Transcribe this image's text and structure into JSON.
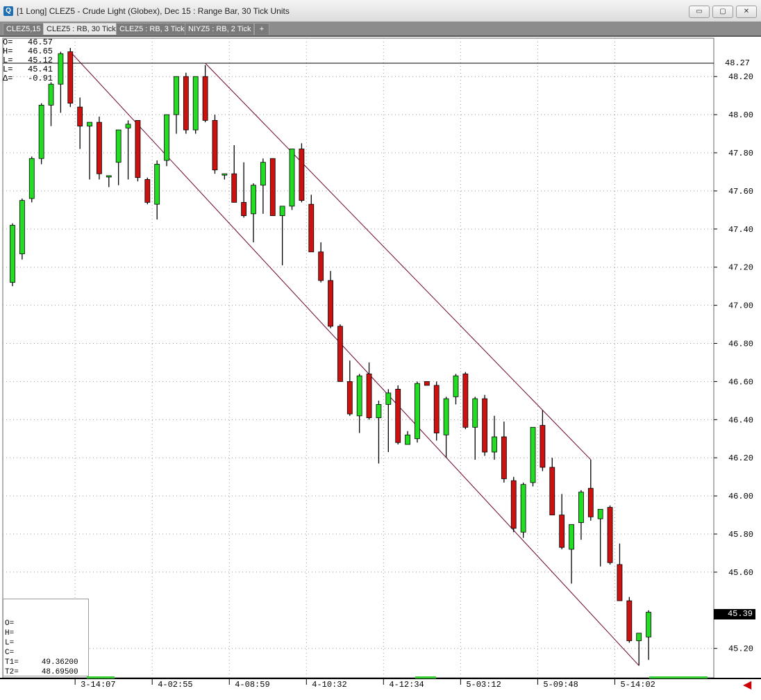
{
  "window": {
    "title": "[1 Long]  CLEZ5 - Crude Light (Globex), Dec 15 : Range Bar, 30 Tick Units",
    "app_icon_glyph": "Q",
    "buttons": {
      "minimize": "▭",
      "restore": "▢",
      "close": "✕"
    }
  },
  "tabs": [
    {
      "label": "CLEZ5,15",
      "active": false
    },
    {
      "label": "CLEZ5 : RB, 30 Tick",
      "active": true
    },
    {
      "label": "CLEZ5 : RB, 3 Tick",
      "active": false
    },
    {
      "label": "NIYZ5 : RB, 2 Tick",
      "active": false
    },
    {
      "label": "+",
      "active": false
    }
  ],
  "ohlc_panel": {
    "o": "O=   46.57",
    "h": "H=   46.65",
    "l1": "L=   45.12",
    "l2": "L=   45.41",
    "delta": "Δ=   -0.91"
  },
  "info_box": {
    "o": "O=",
    "h": "H=",
    "l": "L=",
    "c": "C=",
    "t1": "T1=     49.36200",
    "t2": "T2=     48.69500"
  },
  "price_tag": "45.39",
  "horizontal_line_tag": "48.27",
  "colors": {
    "up": "#22dd22",
    "down": "#cc1111",
    "trendline": "#6a0030",
    "grid": "#999999"
  },
  "icons": {
    "scroll_right": "arrow-left-icon"
  },
  "chart_data": {
    "type": "candlestick",
    "ylim": [
      45.08,
      48.35
    ],
    "yticks": [
      "48.20",
      "48.00",
      "47.80",
      "47.60",
      "47.40",
      "47.20",
      "47.00",
      "46.80",
      "46.60",
      "46.40",
      "46.20",
      "46.00",
      "45.80",
      "45.60",
      "45.20"
    ],
    "xticks": [
      {
        "label": "3-14:07",
        "bar": 7
      },
      {
        "label": "4-02:55",
        "bar": 15
      },
      {
        "label": "4-08:59",
        "bar": 23
      },
      {
        "label": "4-10:32",
        "bar": 31
      },
      {
        "label": "4-12:34",
        "bar": 39
      },
      {
        "label": "5-03:12",
        "bar": 47
      },
      {
        "label": "5-09:48",
        "bar": 55
      },
      {
        "label": "5-14:02",
        "bar": 63
      }
    ],
    "hline": 48.27,
    "bars": [
      {
        "o": 47.12,
        "h": 47.43,
        "l": 47.1,
        "c": 47.42
      },
      {
        "o": 47.27,
        "h": 47.56,
        "l": 47.24,
        "c": 47.55
      },
      {
        "o": 47.56,
        "h": 47.78,
        "l": 47.54,
        "c": 47.77
      },
      {
        "o": 47.77,
        "h": 48.06,
        "l": 47.74,
        "c": 48.05
      },
      {
        "o": 48.05,
        "h": 48.17,
        "l": 47.94,
        "c": 48.16
      },
      {
        "o": 48.16,
        "h": 48.33,
        "l": 48.01,
        "c": 48.32
      },
      {
        "o": 48.33,
        "h": 48.35,
        "l": 48.04,
        "c": 48.06
      },
      {
        "o": 48.04,
        "h": 48.09,
        "l": 47.82,
        "c": 47.94
      },
      {
        "o": 47.94,
        "h": 47.96,
        "l": 47.66,
        "c": 47.96
      },
      {
        "o": 47.96,
        "h": 47.99,
        "l": 47.66,
        "c": 47.69
      },
      {
        "o": 47.68,
        "h": 47.68,
        "l": 47.62,
        "c": 47.68
      },
      {
        "o": 47.75,
        "h": 47.92,
        "l": 47.63,
        "c": 47.92
      },
      {
        "o": 47.93,
        "h": 47.97,
        "l": 47.66,
        "c": 47.95
      },
      {
        "o": 47.97,
        "h": 47.97,
        "l": 47.65,
        "c": 47.67
      },
      {
        "o": 47.66,
        "h": 47.67,
        "l": 47.53,
        "c": 47.54
      },
      {
        "o": 47.53,
        "h": 47.76,
        "l": 47.45,
        "c": 47.74
      },
      {
        "o": 47.76,
        "h": 48.0,
        "l": 47.73,
        "c": 48.0
      },
      {
        "o": 48.0,
        "h": 48.2,
        "l": 47.9,
        "c": 48.2
      },
      {
        "o": 48.2,
        "h": 48.22,
        "l": 47.9,
        "c": 47.92
      },
      {
        "o": 47.92,
        "h": 48.2,
        "l": 47.9,
        "c": 48.2
      },
      {
        "o": 48.2,
        "h": 48.26,
        "l": 47.96,
        "c": 47.97
      },
      {
        "o": 47.97,
        "h": 48.0,
        "l": 47.69,
        "c": 47.71
      },
      {
        "o": 47.69,
        "h": 47.69,
        "l": 47.66,
        "c": 47.69
      },
      {
        "o": 47.69,
        "h": 47.84,
        "l": 47.54,
        "c": 47.54
      },
      {
        "o": 47.54,
        "h": 47.75,
        "l": 47.46,
        "c": 47.47
      },
      {
        "o": 47.48,
        "h": 47.64,
        "l": 47.33,
        "c": 47.63
      },
      {
        "o": 47.63,
        "h": 47.77,
        "l": 47.48,
        "c": 47.75
      },
      {
        "o": 47.77,
        "h": 47.77,
        "l": 47.47,
        "c": 47.47
      },
      {
        "o": 47.47,
        "h": 47.52,
        "l": 47.21,
        "c": 47.52
      },
      {
        "o": 47.52,
        "h": 47.82,
        "l": 47.5,
        "c": 47.82
      },
      {
        "o": 47.82,
        "h": 47.85,
        "l": 47.54,
        "c": 47.55
      },
      {
        "o": 47.53,
        "h": 47.58,
        "l": 47.28,
        "c": 47.28
      },
      {
        "o": 47.28,
        "h": 47.33,
        "l": 47.12,
        "c": 47.13
      },
      {
        "o": 47.13,
        "h": 47.18,
        "l": 46.88,
        "c": 46.89
      },
      {
        "o": 46.89,
        "h": 46.9,
        "l": 46.6,
        "c": 46.6
      },
      {
        "o": 46.6,
        "h": 46.71,
        "l": 46.42,
        "c": 46.43
      },
      {
        "o": 46.42,
        "h": 46.64,
        "l": 46.33,
        "c": 46.63
      },
      {
        "o": 46.64,
        "h": 46.7,
        "l": 46.4,
        "c": 46.41
      },
      {
        "o": 46.41,
        "h": 46.5,
        "l": 46.17,
        "c": 46.48
      },
      {
        "o": 46.48,
        "h": 46.56,
        "l": 46.23,
        "c": 46.54
      },
      {
        "o": 46.56,
        "h": 46.58,
        "l": 46.27,
        "c": 46.28
      },
      {
        "o": 46.27,
        "h": 46.34,
        "l": 46.27,
        "c": 46.32
      },
      {
        "o": 46.3,
        "h": 46.6,
        "l": 46.28,
        "c": 46.59
      },
      {
        "o": 46.6,
        "h": 46.6,
        "l": 46.58,
        "c": 46.58
      },
      {
        "o": 46.58,
        "h": 46.6,
        "l": 46.29,
        "c": 46.33
      },
      {
        "o": 46.32,
        "h": 46.52,
        "l": 46.2,
        "c": 46.51
      },
      {
        "o": 46.52,
        "h": 46.64,
        "l": 46.48,
        "c": 46.63
      },
      {
        "o": 46.64,
        "h": 46.65,
        "l": 46.35,
        "c": 46.36
      },
      {
        "o": 46.36,
        "h": 46.52,
        "l": 46.19,
        "c": 46.51
      },
      {
        "o": 46.51,
        "h": 46.53,
        "l": 46.21,
        "c": 46.23
      },
      {
        "o": 46.23,
        "h": 46.42,
        "l": 46.19,
        "c": 46.31
      },
      {
        "o": 46.31,
        "h": 46.39,
        "l": 46.07,
        "c": 46.09
      },
      {
        "o": 46.08,
        "h": 46.1,
        "l": 45.81,
        "c": 45.83
      },
      {
        "o": 45.81,
        "h": 46.07,
        "l": 45.78,
        "c": 46.06
      },
      {
        "o": 46.07,
        "h": 46.36,
        "l": 46.05,
        "c": 46.36
      },
      {
        "o": 46.37,
        "h": 46.45,
        "l": 46.13,
        "c": 46.15
      },
      {
        "o": 46.15,
        "h": 46.2,
        "l": 45.9,
        "c": 45.9
      },
      {
        "o": 45.9,
        "h": 46.01,
        "l": 45.72,
        "c": 45.73
      },
      {
        "o": 45.72,
        "h": 45.85,
        "l": 45.54,
        "c": 45.85
      },
      {
        "o": 45.86,
        "h": 46.03,
        "l": 45.77,
        "c": 46.02
      },
      {
        "o": 46.04,
        "h": 46.19,
        "l": 45.87,
        "c": 45.89
      },
      {
        "o": 45.88,
        "h": 45.93,
        "l": 45.63,
        "c": 45.93
      },
      {
        "o": 45.94,
        "h": 45.95,
        "l": 45.64,
        "c": 45.65
      },
      {
        "o": 45.64,
        "h": 45.75,
        "l": 45.45,
        "c": 45.45
      },
      {
        "o": 45.45,
        "h": 45.47,
        "l": 45.23,
        "c": 45.24
      },
      {
        "o": 45.24,
        "h": 45.28,
        "l": 45.11,
        "c": 45.28
      },
      {
        "o": 45.26,
        "h": 45.4,
        "l": 45.14,
        "c": 45.39
      }
    ],
    "trendlines": [
      {
        "from": {
          "bar": 6,
          "price": 48.33
        },
        "to": {
          "bar": 65,
          "price": 45.11
        }
      },
      {
        "from": {
          "bar": 20,
          "price": 48.27
        },
        "to": {
          "bar": 60,
          "price": 46.19
        }
      }
    ]
  }
}
